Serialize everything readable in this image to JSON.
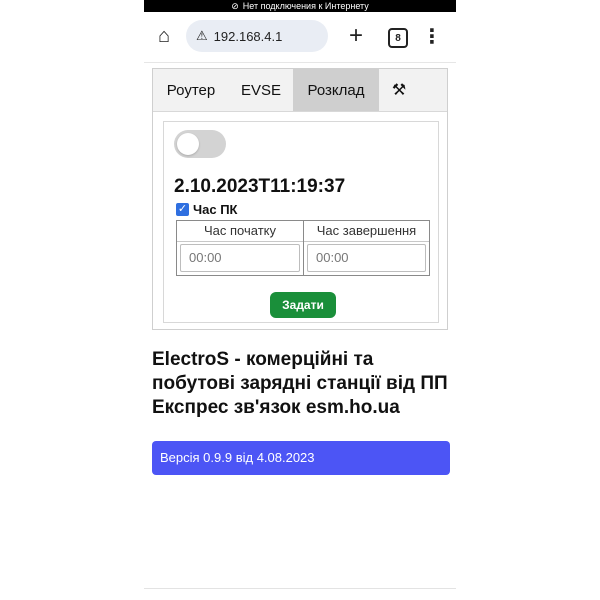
{
  "status_bar": {
    "text": "Нет подключения к Интернету",
    "icon": "no-wifi-icon"
  },
  "browser": {
    "url": "192.168.4.1",
    "tab_count": "8"
  },
  "tabs": [
    {
      "label": "Роутер"
    },
    {
      "label": "EVSE"
    },
    {
      "label": "Розклад"
    }
  ],
  "schedule": {
    "datetime": "2.10.2023T11:19:37",
    "pc_time_label": "Час ПК",
    "start_header": "Час початку",
    "end_header": "Час завершення",
    "start_value": "00:00",
    "end_value": "00:00",
    "set_button": "Задати"
  },
  "heading": "ElectroS - комерційні та побутові зарядні станції від ПП Експрес зв'язок esm.ho.ua",
  "version": "Версія 0.9.9 від 4.08.2023",
  "colors": {
    "accent": "#4c55f5",
    "button": "#1a8f3a",
    "checkbox": "#2f6fe0"
  }
}
